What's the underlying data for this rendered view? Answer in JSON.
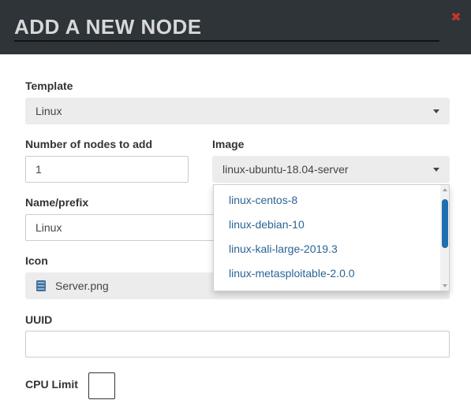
{
  "dialog": {
    "title": "ADD A NEW NODE",
    "close_icon": "close-icon"
  },
  "colors": {
    "header_bg": "#2e3438",
    "close": "#c0392b",
    "link": "#2a6496",
    "scroll_thumb": "#1f6fb3"
  },
  "form": {
    "template": {
      "label": "Template",
      "value": "Linux"
    },
    "nodes_count": {
      "label": "Number of nodes to add",
      "value": "1"
    },
    "image": {
      "label": "Image",
      "value": "linux-ubuntu-18.04-server",
      "options": [
        "linux-centos-8",
        "linux-debian-10",
        "linux-kali-large-2019.3",
        "linux-metasploitable-2.0.0"
      ]
    },
    "name_prefix": {
      "label": "Name/prefix",
      "value": "Linux"
    },
    "icon": {
      "label": "Icon",
      "value": "Server.png",
      "icon": "server-icon"
    },
    "uuid": {
      "label": "UUID",
      "value": ""
    },
    "cpu_limit": {
      "label": "CPU Limit",
      "checked": false
    }
  }
}
